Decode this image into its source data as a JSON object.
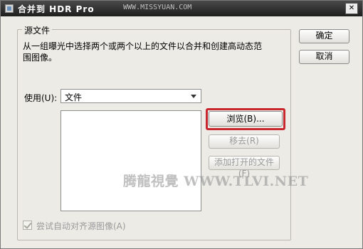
{
  "window": {
    "title": "合并到 HDR Pro",
    "watermark_top": "WWW.MISSYUAN.COM",
    "close_label": "✕"
  },
  "source_group": {
    "title": "源文件",
    "description": "从一组曝光中选择两个或两个以上的文件以合并和创建高动态范围图像。"
  },
  "use": {
    "label": "使用(U):",
    "selected": "文件"
  },
  "buttons": {
    "ok": "确定",
    "cancel": "取消",
    "browse": "浏览(B)...",
    "remove": "移去(R)",
    "add_open": "添加打开的文件(F)"
  },
  "checkbox": {
    "label": "尝试自动对齐源图像(A)",
    "checked": true,
    "enabled": false
  },
  "watermark": "腾龍視覺 WWW.TLVI.NET",
  "colors": {
    "highlight": "#c8282d",
    "dialog_bg": "#ecebe6",
    "titlebar": "#2a2a2a"
  }
}
